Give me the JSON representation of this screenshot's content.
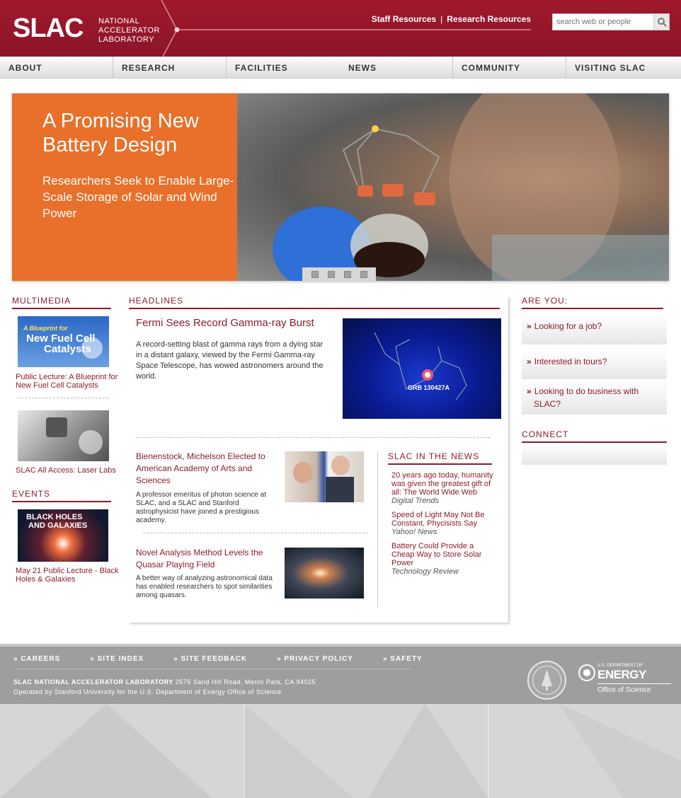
{
  "brand": {
    "logo": "SLAC",
    "name_lines": [
      "NATIONAL",
      "ACCELERATOR",
      "LABORATORY"
    ]
  },
  "top_links": [
    "Staff Resources",
    "Research Resources"
  ],
  "search": {
    "placeholder": "search web or people"
  },
  "nav": [
    "ABOUT",
    "RESEARCH",
    "FACILITIES",
    "NEWS",
    "COMMUNITY",
    "VISITING SLAC"
  ],
  "hero": {
    "title": "A Promising New Battery Design",
    "subtitle": "Researchers Seek to Enable Large-Scale Storage of Solar and Wind Power",
    "slide_count": 4
  },
  "multimedia": {
    "heading": "MULTIMEDIA",
    "items": [
      {
        "thumb_text": "A Blueprint for New Fuel Cell Catalysts",
        "label": "Public Lecture: A Blueprint for New Fuel Cell Catalysts"
      },
      {
        "label": "SLAC All Access: Laser Labs"
      }
    ]
  },
  "events": {
    "heading": "EVENTS",
    "items": [
      {
        "thumb_text": "BLACK HOLES AND GALAXIES",
        "label": "May 21 Public Lecture - Black Holes & Galaxies"
      }
    ]
  },
  "headlines": {
    "heading": "HEADLINES",
    "feature": {
      "title": "Fermi Sees Record Gamma-ray Burst",
      "text": "A record-setting blast of gamma rays from a dying star in a distant galaxy, viewed by the Fermi Gamma-ray Space Telescope, has wowed astronomers around the world.",
      "image_label": "GRB 130427A"
    },
    "stories": [
      {
        "title": "Bienenstock, Michelson Elected to American Academy of Arts and Sciences",
        "text": "A professor emeritus of photon science at SLAC, and a SLAC and Stanford astrophysicist have joined a prestigious academy."
      },
      {
        "title": "Novel Analysis Method Levels the Quasar Playing Field",
        "text": "A better way of analyzing astronomical data has enabled researchers to spot similarities among quasars."
      }
    ]
  },
  "in_the_news": {
    "heading": "SLAC IN THE NEWS",
    "items": [
      {
        "title": "20 years ago today, humanity was given the greatest gift of all: The World Wide Web",
        "source": "Digital Trends"
      },
      {
        "title": "Speed of Light May Not Be Constant, Phycisists Say",
        "source": "Yahoo! News"
      },
      {
        "title": "Battery Could Provide a Cheap Way to Store Solar Power",
        "source": "Technology Review"
      }
    ]
  },
  "are_you": {
    "heading": "ARE YOU:",
    "items": [
      "Looking for a job?",
      "Interested in tours?",
      "Looking to do business with SLAC?"
    ],
    "chevron": "»"
  },
  "connect": {
    "heading": "CONNECT"
  },
  "footer": {
    "links": [
      "» CAREERS",
      "» SITE INDEX",
      "» SITE FEEDBACK",
      "» PRIVACY POLICY",
      "» SAFETY"
    ],
    "lab_name": "SLAC NATIONAL ACCELERATOR LABORATORY",
    "address": "2575 Sand Hill Road, Menlo Park, CA 94025",
    "operated_by": "Operated by Stanford University for the U.S. Department of Energy Office of Science",
    "doe_small": "U.S. DEPARTMENT OF",
    "doe_big": "ENERGY",
    "doe_office": "Office of Science"
  },
  "colors": {
    "brand_red": "#9b1b2e",
    "hero_orange": "#e8702a",
    "link_red": "#8c1c2c",
    "footer_gray": "#9e9e9e"
  }
}
